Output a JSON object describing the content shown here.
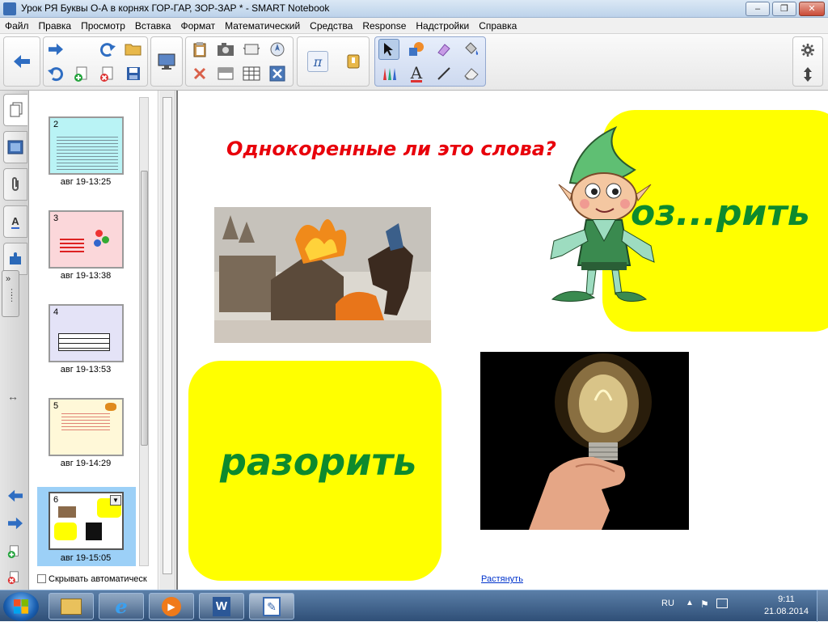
{
  "window": {
    "title": "Урок РЯ Буквы О-А в корнях ГОР-ГАР, ЗОР-ЗАР * - SMART Notebook",
    "minimize": "–",
    "maximize": "❐",
    "close": "✕"
  },
  "menu": [
    "Файл",
    "Правка",
    "Просмотр",
    "Вставка",
    "Формат",
    "Математический",
    "Средства",
    "Response",
    "Надстройки",
    "Справка"
  ],
  "sorter": {
    "pages": [
      {
        "num": "2",
        "time": "авг 19-13:25"
      },
      {
        "num": "3",
        "time": "авг 19-13:38"
      },
      {
        "num": "4",
        "time": "авг 19-13:53"
      },
      {
        "num": "5",
        "time": "авг 19-14:29"
      },
      {
        "num": "6",
        "time": "авг 19-15:05"
      }
    ],
    "autohide_label": "Скрывать автоматическ"
  },
  "slide": {
    "question": "Однокоренные ли это слова?",
    "word_top": "оз...рить",
    "word_bottom": "разорить"
  },
  "canvas": {
    "stretch_link": "Растянуть"
  },
  "taskbar": {
    "language": "RU",
    "time": "9:11",
    "date": "21.08.2014"
  },
  "colors": {
    "yellow": "#ffff00",
    "question_red": "#e8000b",
    "word_green": "#0d8a2d"
  }
}
